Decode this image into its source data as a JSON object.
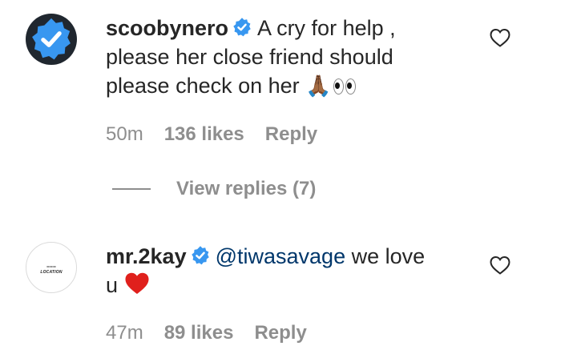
{
  "comments": [
    {
      "username": "scoobynero",
      "text": "A cry for help , please her close friend should please check on her",
      "time": "50m",
      "likes": "136 likes",
      "reply_label": "Reply",
      "view_replies_label": "View replies (7)"
    },
    {
      "username": "mr.2kay",
      "mention": "@tiwasavage",
      "text": "we love u",
      "time": "47m",
      "likes": "89 likes",
      "reply_label": "Reply",
      "avatar_logo_text": "LOCATION"
    }
  ],
  "icons": {
    "verified": "verified-badge-icon",
    "like": "heart-outline-icon",
    "pray_emoji": "🙏🏾",
    "eyes": "eyes-emoji",
    "red_heart": "red-heart-emoji"
  },
  "colors": {
    "verified_blue": "#3897f0",
    "mention": "#00376b",
    "meta_gray": "#8e8e8e",
    "heart_red": "#e0201c"
  }
}
